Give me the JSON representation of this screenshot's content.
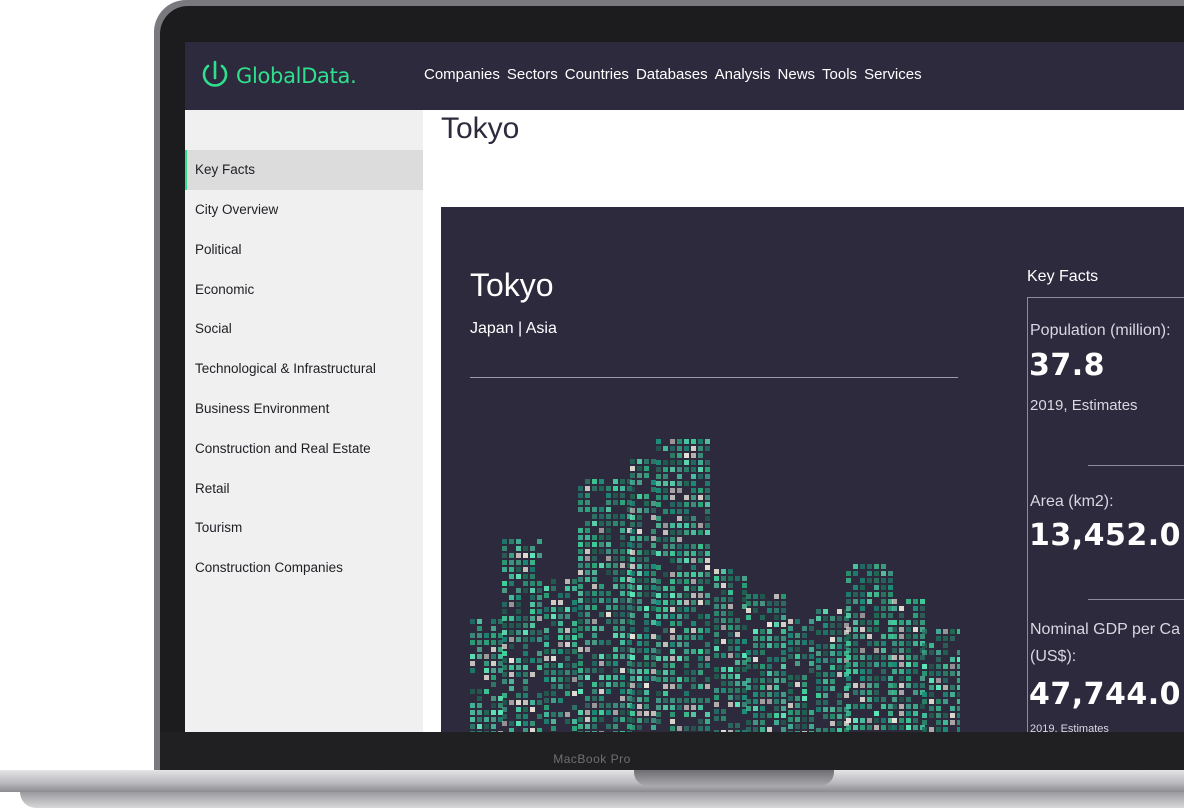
{
  "device": {
    "model_label": "MacBook Pro"
  },
  "brand": {
    "logo_text": "GlobalData.",
    "accent_color": "#2ee08d",
    "nav_bg": "#2e2a3d"
  },
  "nav": {
    "items": [
      "Companies",
      "Sectors",
      "Countries",
      "Databases",
      "Analysis",
      "News",
      "Tools",
      "Services"
    ]
  },
  "sidebar": {
    "items": [
      {
        "label": "Key Facts",
        "active": true
      },
      {
        "label": "City Overview"
      },
      {
        "label": "Political"
      },
      {
        "label": "Economic"
      },
      {
        "label": "Social"
      },
      {
        "label": "Technological & Infrastructural"
      },
      {
        "label": "Business Environment"
      },
      {
        "label": "Construction and Real Estate"
      },
      {
        "label": "Retail"
      },
      {
        "label": "Tourism"
      },
      {
        "label": "Construction Companies"
      }
    ]
  },
  "page": {
    "title": "Tokyo"
  },
  "hero": {
    "city": "Tokyo",
    "region": "Japan | Asia",
    "illustration": "pixel-city-skyline"
  },
  "key_facts": {
    "heading": "Key Facts",
    "items": [
      {
        "label": "Population (million):",
        "value": "37.8",
        "note": "2019, Estimates"
      },
      {
        "label": "Area (km2):",
        "value": "13,452.0",
        "note": ""
      },
      {
        "label_line1": "Nominal GDP per Ca",
        "label_line2": "(US$):",
        "value": "47,744.0",
        "note": "2019, Estimates"
      }
    ]
  }
}
